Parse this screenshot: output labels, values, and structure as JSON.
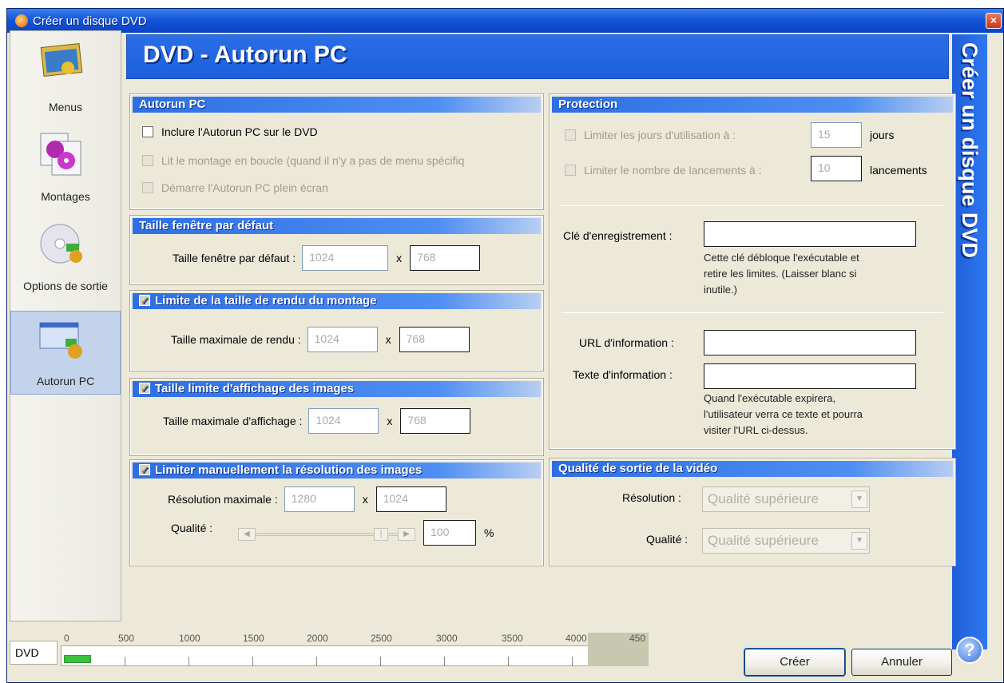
{
  "window": {
    "title": "Créer un disque DVD",
    "close_label": "×"
  },
  "sidebar": {
    "items": [
      {
        "label": "Menus",
        "icon": "menus-icon"
      },
      {
        "label": "Montages",
        "icon": "montages-icon"
      },
      {
        "label": "Options de sortie",
        "icon": "output-options-icon"
      },
      {
        "label": "Autorun PC",
        "icon": "autorun-pc-icon",
        "active": true
      }
    ]
  },
  "header": {
    "title": "DVD - Autorun PC"
  },
  "side_banner": {
    "text": "Créer un disque DVD"
  },
  "autorun": {
    "title": "Autorun PC",
    "include": "Inclure l'Autorun PC sur le DVD",
    "loop": "Lit le montage en boucle (quand il n'y a pas de menu spécifiq",
    "fullscreen": "Démarre l'Autorun PC plein écran"
  },
  "window_size": {
    "title": "Taille fenêtre par défaut",
    "label": "Taille fenêtre par défaut :",
    "width": "1024",
    "x": "x",
    "height": "768"
  },
  "render_limit": {
    "title": "Limite de la taille de rendu du montage",
    "label": "Taille maximale de rendu :",
    "width": "1024",
    "x": "x",
    "height": "768"
  },
  "image_display": {
    "title": "Taille limite d'affichage des images",
    "label": "Taille maximale d'affichage :",
    "width": "1024",
    "x": "x",
    "height": "768"
  },
  "image_resolution": {
    "title": "Limiter manuellement la résolution des images",
    "res_label": "Résolution maximale :",
    "width": "1280",
    "x": "x",
    "height": "1024",
    "quality_label": "Qualité :",
    "quality_value": "100",
    "quality_unit": "%"
  },
  "protection": {
    "title": "Protection",
    "days_label": "Limiter les jours d'utilisation à :",
    "days_value": "15",
    "days_unit": "jours",
    "launches_label": "Limiter le nombre de lancements à :",
    "launches_value": "10",
    "launches_unit": "lancements",
    "key_label": "Clé d'enregistrement :",
    "key_help": [
      "Cette clé débloque l'exécutable et",
      "retire les limites. (Laisser blanc si",
      "inutile.)"
    ],
    "url_label": "URL d'information :",
    "text_label": "Texte d'information :",
    "text_help": [
      "Quand l'exécutable expirera,",
      "l'utilisateur verra ce texte et pourra",
      "visiter l'URL ci-dessus."
    ]
  },
  "video_quality": {
    "title": "Qualité de sortie de la vidéo",
    "res_label": "Résolution :",
    "res_value": "Qualité supérieure",
    "quality_label": "Qualité :",
    "quality_value": "Qualité supérieure"
  },
  "ruler": {
    "label": "DVD",
    "ticks": [
      "0",
      "500",
      "1000",
      "1500",
      "2000",
      "2500",
      "3000",
      "3500",
      "4000",
      "450"
    ],
    "used_fraction": 0.05
  },
  "buttons": {
    "create": "Créer",
    "cancel": "Annuler"
  },
  "colors": {
    "accent": "#2a6ee6",
    "titlebar": "#1556d8",
    "progress": "#3bc140"
  }
}
